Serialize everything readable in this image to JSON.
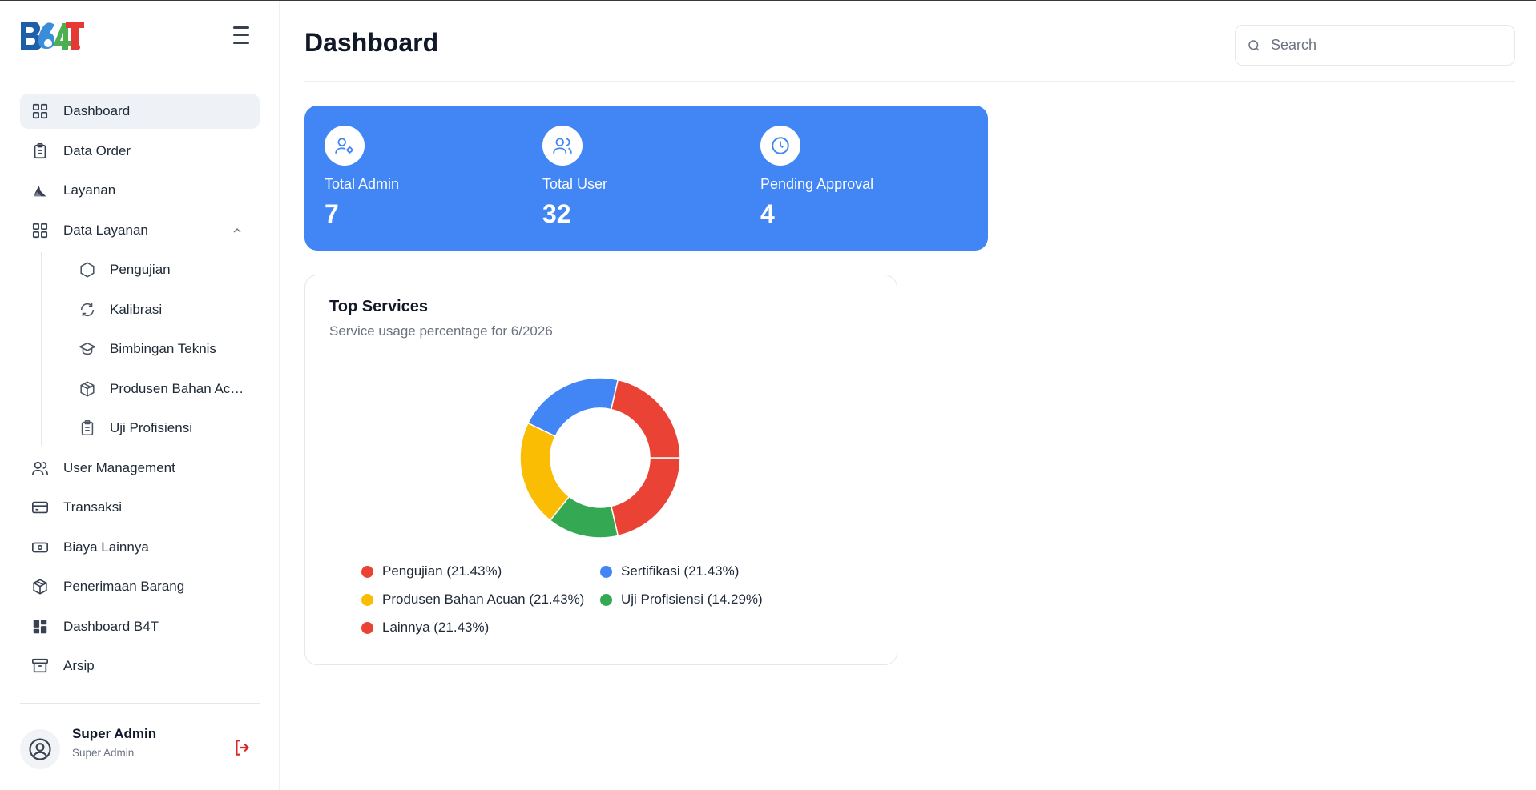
{
  "app": {
    "logo_text": "B4T"
  },
  "sidebar": {
    "items": [
      {
        "label": "Dashboard",
        "icon": "grid-icon"
      },
      {
        "label": "Data Order",
        "icon": "clipboard-icon"
      },
      {
        "label": "Layanan",
        "icon": "layanan-icon"
      },
      {
        "label": "Data Layanan",
        "icon": "grid-icon"
      },
      {
        "label": "User Management",
        "icon": "users-icon"
      },
      {
        "label": "Transaksi",
        "icon": "credit-card-icon"
      },
      {
        "label": "Biaya Lainnya",
        "icon": "banknote-icon"
      },
      {
        "label": "Penerimaan Barang",
        "icon": "package-icon"
      },
      {
        "label": "Dashboard B4T",
        "icon": "dashboard-icon"
      },
      {
        "label": "Arsip",
        "icon": "archive-icon"
      }
    ],
    "sub_items": [
      {
        "label": "Pengujian",
        "icon": "hexagon-icon"
      },
      {
        "label": "Kalibrasi",
        "icon": "refresh-icon"
      },
      {
        "label": "Bimbingan Teknis",
        "icon": "graduation-cap-icon"
      },
      {
        "label": "Produsen Bahan Acuan",
        "icon": "package-icon"
      },
      {
        "label": "Uji Profisiensi",
        "icon": "clipboard-icon"
      }
    ],
    "user": {
      "name": "Super Admin",
      "role": "Super Admin",
      "extra": "-"
    }
  },
  "header": {
    "title": "Dashboard",
    "search_placeholder": "Search"
  },
  "stats": [
    {
      "label": "Total Admin",
      "value": "7",
      "icon": "user-cog-icon"
    },
    {
      "label": "Total User",
      "value": "32",
      "icon": "users-icon"
    },
    {
      "label": "Pending Approval",
      "value": "4",
      "icon": "clock-icon"
    }
  ],
  "top_services": {
    "title": "Top Services",
    "subtitle": "Service usage percentage for 6/2026",
    "legend": [
      "Pengujian (21.43%)",
      "Sertifikasi (21.43%)",
      "Produsen Bahan Acuan (21.43%)",
      "Uji Profisiensi (14.29%)",
      "Lainnya (21.43%)"
    ]
  },
  "colors": {
    "accent": "#4285f4",
    "red": "#ea4335",
    "blue": "#4285f4",
    "yellow": "#fbbc04",
    "green": "#34a853",
    "logout": "#dc2626"
  },
  "chart_data": {
    "type": "pie",
    "title": "Top Services",
    "subtitle": "Service usage percentage for 6/2026",
    "categories": [
      "Pengujian",
      "Sertifikasi",
      "Produsen Bahan Acuan",
      "Uji Profisiensi",
      "Lainnya"
    ],
    "values": [
      21.43,
      21.43,
      21.43,
      14.29,
      21.43
    ],
    "colors": [
      "#ea4335",
      "#4285f4",
      "#fbbc04",
      "#34a853",
      "#ea4335"
    ],
    "legend": "bottom"
  }
}
